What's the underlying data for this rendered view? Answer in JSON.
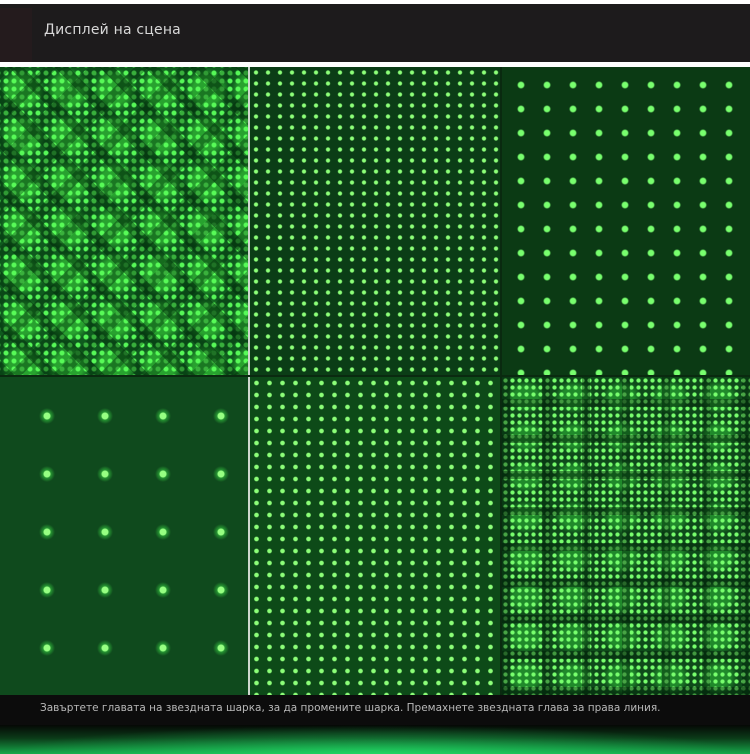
{
  "header": {
    "title": "Дисплей на сцена"
  },
  "gallery": {
    "panels": [
      {
        "pattern": "diamond-lattice"
      },
      {
        "pattern": "dense-dots"
      },
      {
        "pattern": "sparse-dots"
      },
      {
        "pattern": "large-dot-grid"
      },
      {
        "pattern": "dense-dots"
      },
      {
        "pattern": "clustered-blocks"
      }
    ]
  },
  "caption": {
    "text": "Завъртете главата на звездната шарка, за да промените шарка. Премахнете звездната глава за права линия."
  },
  "colors": {
    "header_bg": "#1d1b1c",
    "laser_green": "#3cff5a",
    "caption_bg": "#0c0c0c"
  }
}
